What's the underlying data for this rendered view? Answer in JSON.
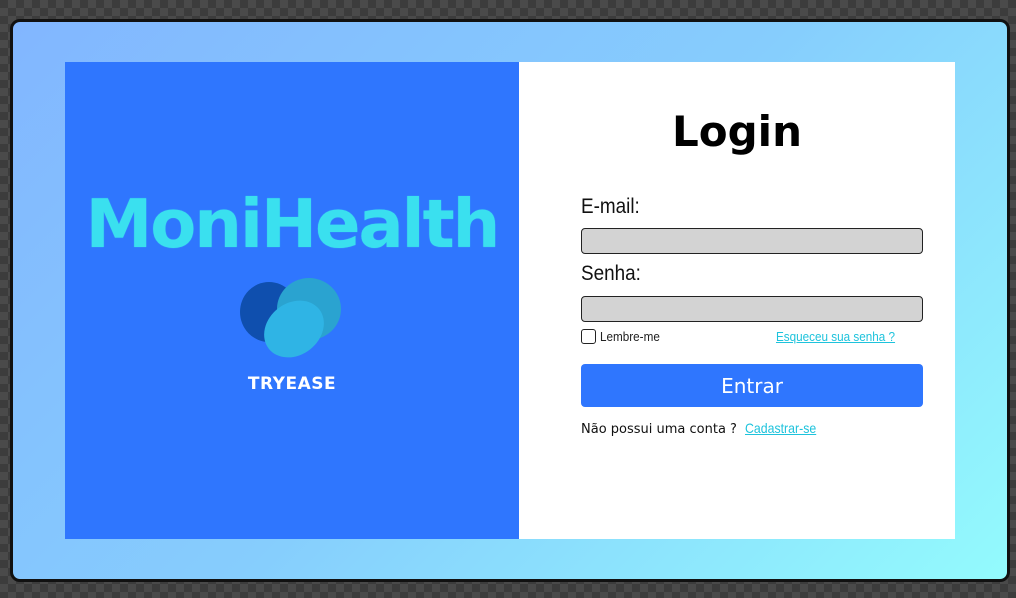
{
  "brand": {
    "name": "MoniHealth",
    "sub": "TRYEASE",
    "logo_icon": "heart-icon"
  },
  "login": {
    "title": "Login",
    "email_label": "E-mail:",
    "email_value": "",
    "email_placeholder": "",
    "password_label": "Senha:",
    "password_value": "",
    "password_placeholder": "",
    "remember_label": "Lembre-me",
    "remember_checked": false,
    "forgot_link": "Esqueceu sua senha ?",
    "submit_label": "Entrar",
    "no_account_text": "Não possui uma conta ?",
    "signup_link": "Cadastrar-se"
  },
  "colors": {
    "primary": "#2f76fe",
    "brand_text": "#3ae0ef",
    "link": "#1ec3dc",
    "input_bg": "#d3d3d3",
    "gradient_start": "#82b6ff",
    "gradient_end": "#93fbfd"
  }
}
